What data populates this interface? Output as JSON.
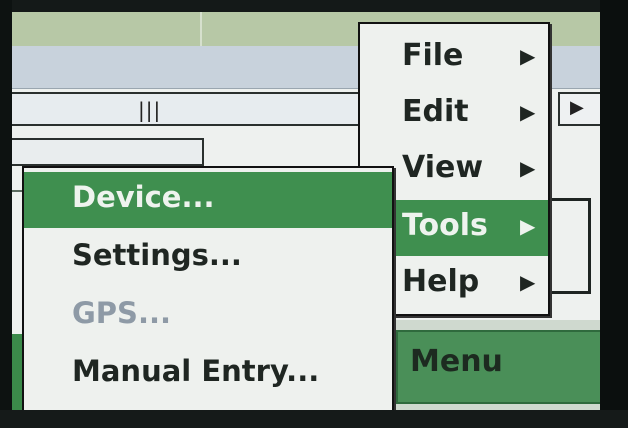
{
  "menu": {
    "items": [
      {
        "label": "File",
        "arrow": "▶"
      },
      {
        "label": "Edit",
        "arrow": "▶"
      },
      {
        "label": "View",
        "arrow": "▶"
      },
      {
        "label": "Tools",
        "arrow": "▶"
      },
      {
        "label": "Help",
        "arrow": "▶"
      }
    ],
    "active_item": "Tools"
  },
  "submenu": {
    "items": [
      {
        "label": "Device..."
      },
      {
        "label": "Settings..."
      },
      {
        "label": "GPS..."
      },
      {
        "label": "Manual Entry..."
      }
    ],
    "highlighted_item": "Device...",
    "disabled_item": "GPS..."
  },
  "softkey": {
    "label": "Menu"
  },
  "background": {
    "grip_glyph": "|||",
    "scroll_arrow": "▶"
  },
  "colors": {
    "highlight": "#3f8f4f",
    "menu_bg": "#eef1ee",
    "disabled_text": "#8e9aa6"
  }
}
